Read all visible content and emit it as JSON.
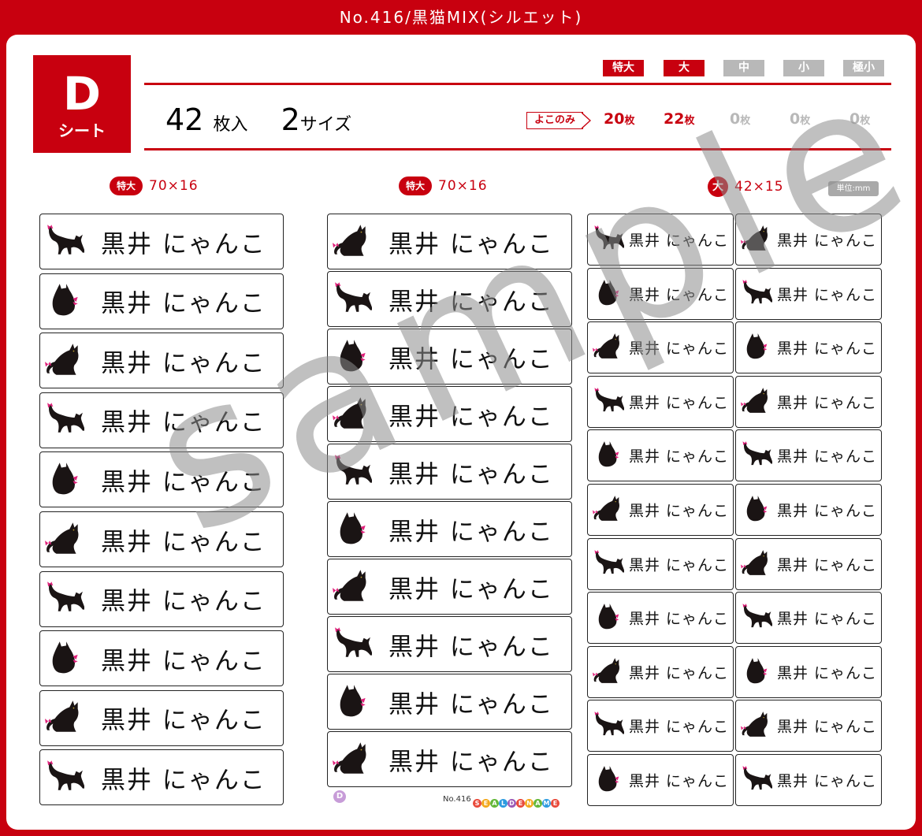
{
  "header": {
    "title": "No.416/黒猫MIX(シルエット)"
  },
  "sheet": {
    "letter": "D",
    "label": "シート"
  },
  "summary": {
    "count": "42",
    "count_unit": "枚入",
    "sizes": "2",
    "sizes_unit": "サイズ"
  },
  "size_badges": [
    {
      "label": "特大",
      "active": true
    },
    {
      "label": "大",
      "active": true
    },
    {
      "label": "中",
      "active": false
    },
    {
      "label": "小",
      "active": false
    },
    {
      "label": "極小",
      "active": false
    }
  ],
  "yoko": "よこのみ",
  "counts": [
    {
      "num": "20",
      "unit": "枚",
      "active": true
    },
    {
      "num": "22",
      "unit": "枚",
      "active": true
    },
    {
      "num": "0",
      "unit": "枚",
      "active": false
    },
    {
      "num": "0",
      "unit": "枚",
      "active": false
    },
    {
      "num": "0",
      "unit": "枚",
      "active": false
    }
  ],
  "columns": [
    {
      "badge": "特大",
      "dims": "70×16"
    },
    {
      "badge": "特大",
      "dims": "70×16"
    },
    {
      "badge": "大",
      "dims": "42×15"
    }
  ],
  "unit_note": "単位:mm",
  "label_text": "黒井 にゃんこ",
  "watermark": "sample",
  "footer": {
    "badge": "D",
    "no": "No.416",
    "logo": [
      "S",
      "E",
      "A",
      "L",
      "D",
      "E",
      "N",
      "A",
      "M",
      "E"
    ]
  },
  "colors": {
    "accent": "#c8000f",
    "inactive": "#b8b8b8",
    "ribbon": "#e0207a"
  },
  "icons": [
    "cat-crouch-icon",
    "cat-sit-back-icon",
    "cat-sit-side-icon"
  ]
}
